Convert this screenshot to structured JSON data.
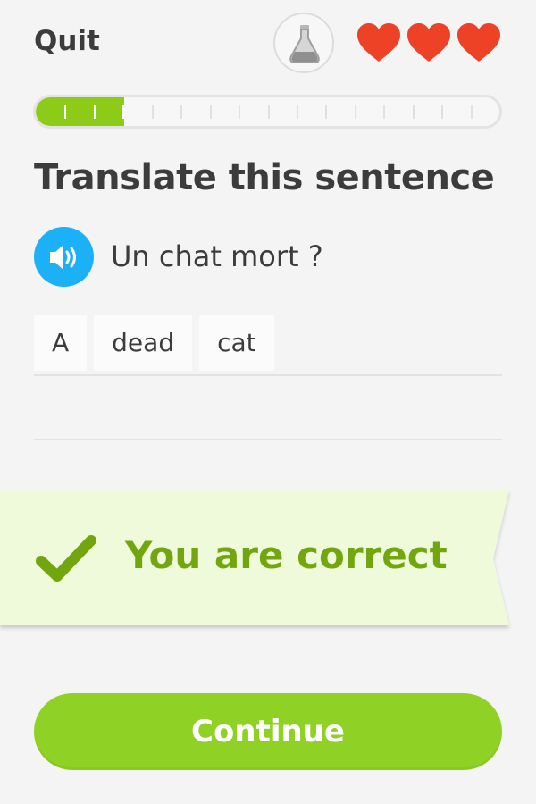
{
  "header": {
    "quit_label": "Quit",
    "potion_icon": "potion-flask-icon",
    "hearts": 3,
    "heart_color": "#ee4226"
  },
  "progress": {
    "fraction": 0.19,
    "segments": 16,
    "completed_segments": 3,
    "fill_color": "#8ccc18"
  },
  "exercise": {
    "title": "Translate this sentence",
    "prompt": "Un chat mort ?",
    "speaker_icon": "speaker-icon",
    "answer_words": [
      "A",
      "dead",
      "cat"
    ]
  },
  "feedback": {
    "message": "You are correct",
    "icon": "checkmark-icon",
    "color": "#72a60f",
    "background": "#eefad9"
  },
  "actions": {
    "continue_label": "Continue",
    "color": "#8fd124"
  }
}
